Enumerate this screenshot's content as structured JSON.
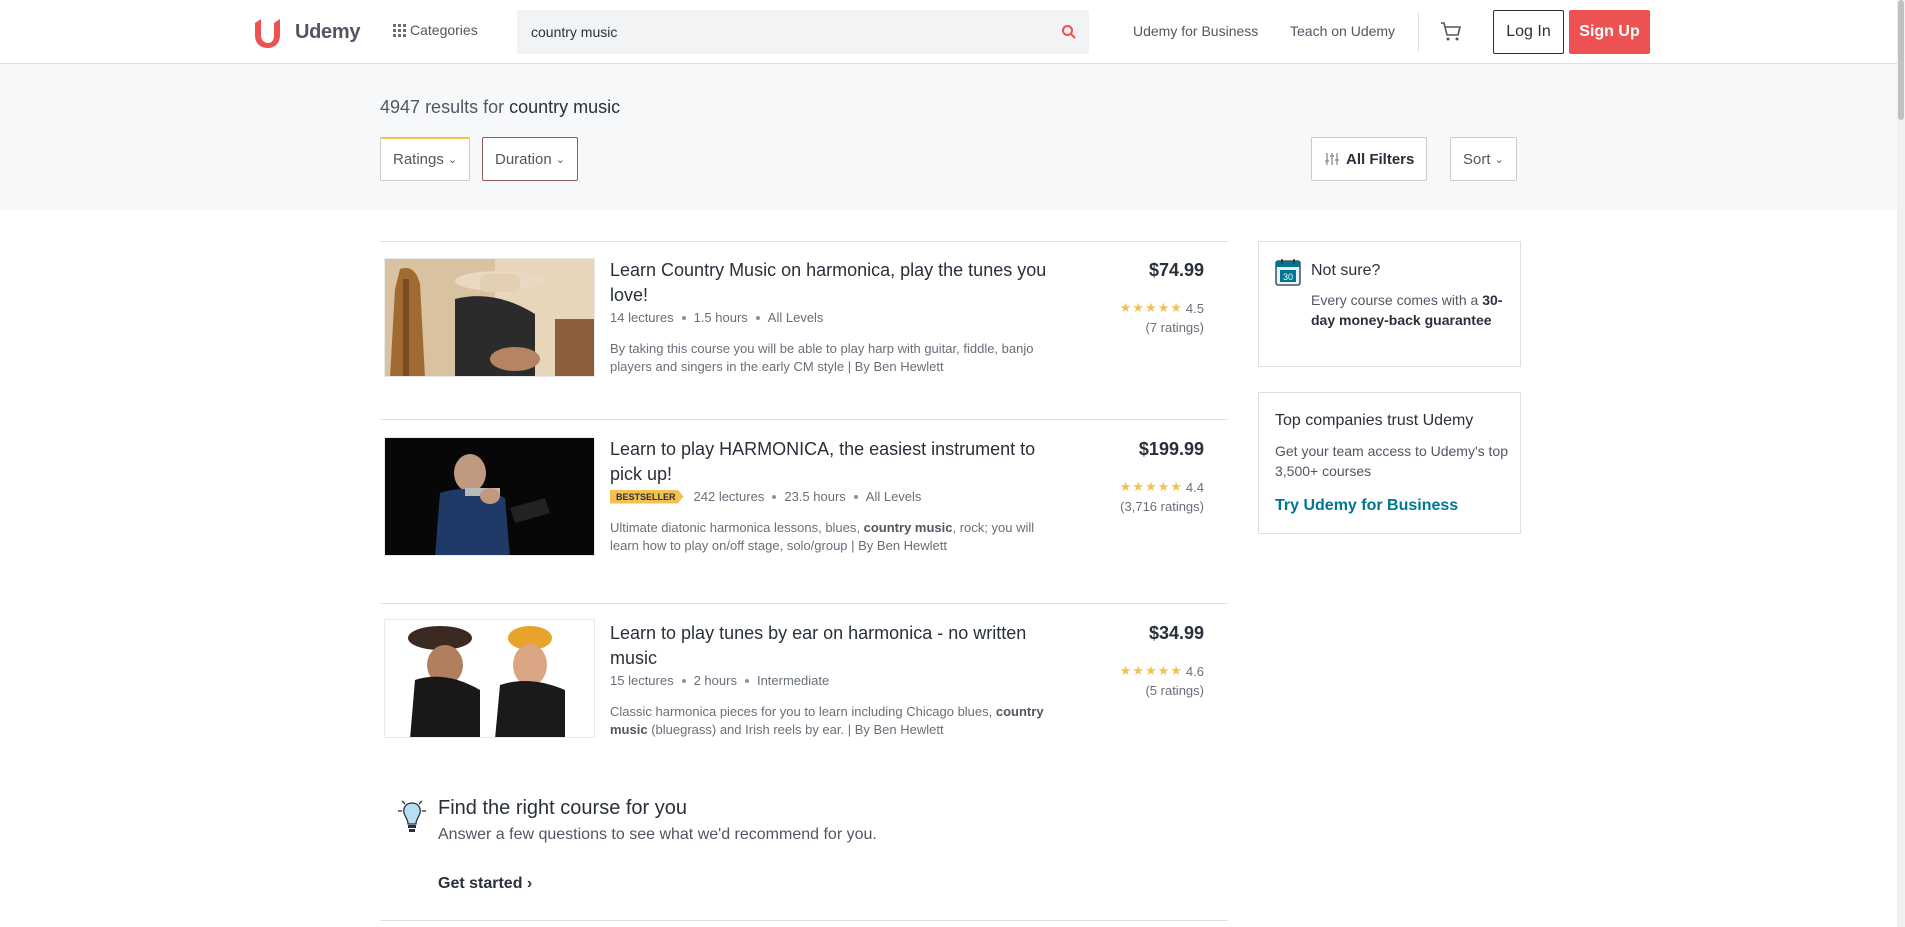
{
  "header": {
    "logo_text": "Udemy",
    "categories_label": "Categories",
    "search_value": "country music",
    "nav_business": "Udemy for Business",
    "nav_teach": "Teach on Udemy",
    "login_label": "Log In",
    "signup_label": "Sign Up"
  },
  "results": {
    "count": "4947",
    "label": "results for",
    "query": "country music"
  },
  "filters": {
    "ratings": "Ratings",
    "duration": "Duration",
    "all_filters": "All Filters",
    "sort": "Sort"
  },
  "courses": [
    {
      "title": "Learn Country Music on harmonica, play the tunes you love!",
      "badge": "",
      "lectures": "14 lectures",
      "hours": "1.5 hours",
      "level": "All Levels",
      "description": "By taking this course you will be able to play harp with guitar, fiddle, banjo players and singers in the early CM style | By Ben Hewlett",
      "price": "$74.99",
      "rating": "4.5",
      "rating_count": "(7 ratings)"
    },
    {
      "title": "Learn to play HARMONICA, the easiest instrument to pick up!",
      "badge": "BESTSELLER",
      "lectures": "242 lectures",
      "hours": "23.5 hours",
      "level": "All Levels",
      "description_before": "Ultimate diatonic harmonica lessons, blues, ",
      "description_bold": "country music",
      "description_after": ", rock; you will learn how to play on/off stage, solo/group | By Ben Hewlett",
      "price": "$199.99",
      "rating": "4.4",
      "rating_count": "(3,716 ratings)"
    },
    {
      "title": "Learn to play tunes by ear on harmonica - no written music",
      "badge": "",
      "lectures": "15 lectures",
      "hours": "2 hours",
      "level": "Intermediate",
      "description_before": "Classic harmonica pieces for you to learn including Chicago blues, ",
      "description_bold": "country music",
      "description_after": " (bluegrass) and Irish reels by ear. | By Ben Hewlett",
      "price": "$34.99",
      "rating": "4.6",
      "rating_count": "(5 ratings)"
    }
  ],
  "find_course": {
    "title": "Find the right course for you",
    "subtitle": "Answer a few questions to see what we'd recommend for you.",
    "link": "Get started ›"
  },
  "sidebar": {
    "not_sure_title": "Not sure?",
    "not_sure_text": "Every course comes with a",
    "not_sure_bold": "30-day money-back guarantee",
    "calendar_number": "30",
    "companies_title": "Top companies trust Udemy",
    "companies_text": "Get your team access to Udemy's top 3,500+ courses",
    "companies_link": "Try Udemy for Business"
  },
  "colors": {
    "brand_red": "#ec5252",
    "star_yellow": "#f4c150",
    "link_teal": "#007791"
  }
}
